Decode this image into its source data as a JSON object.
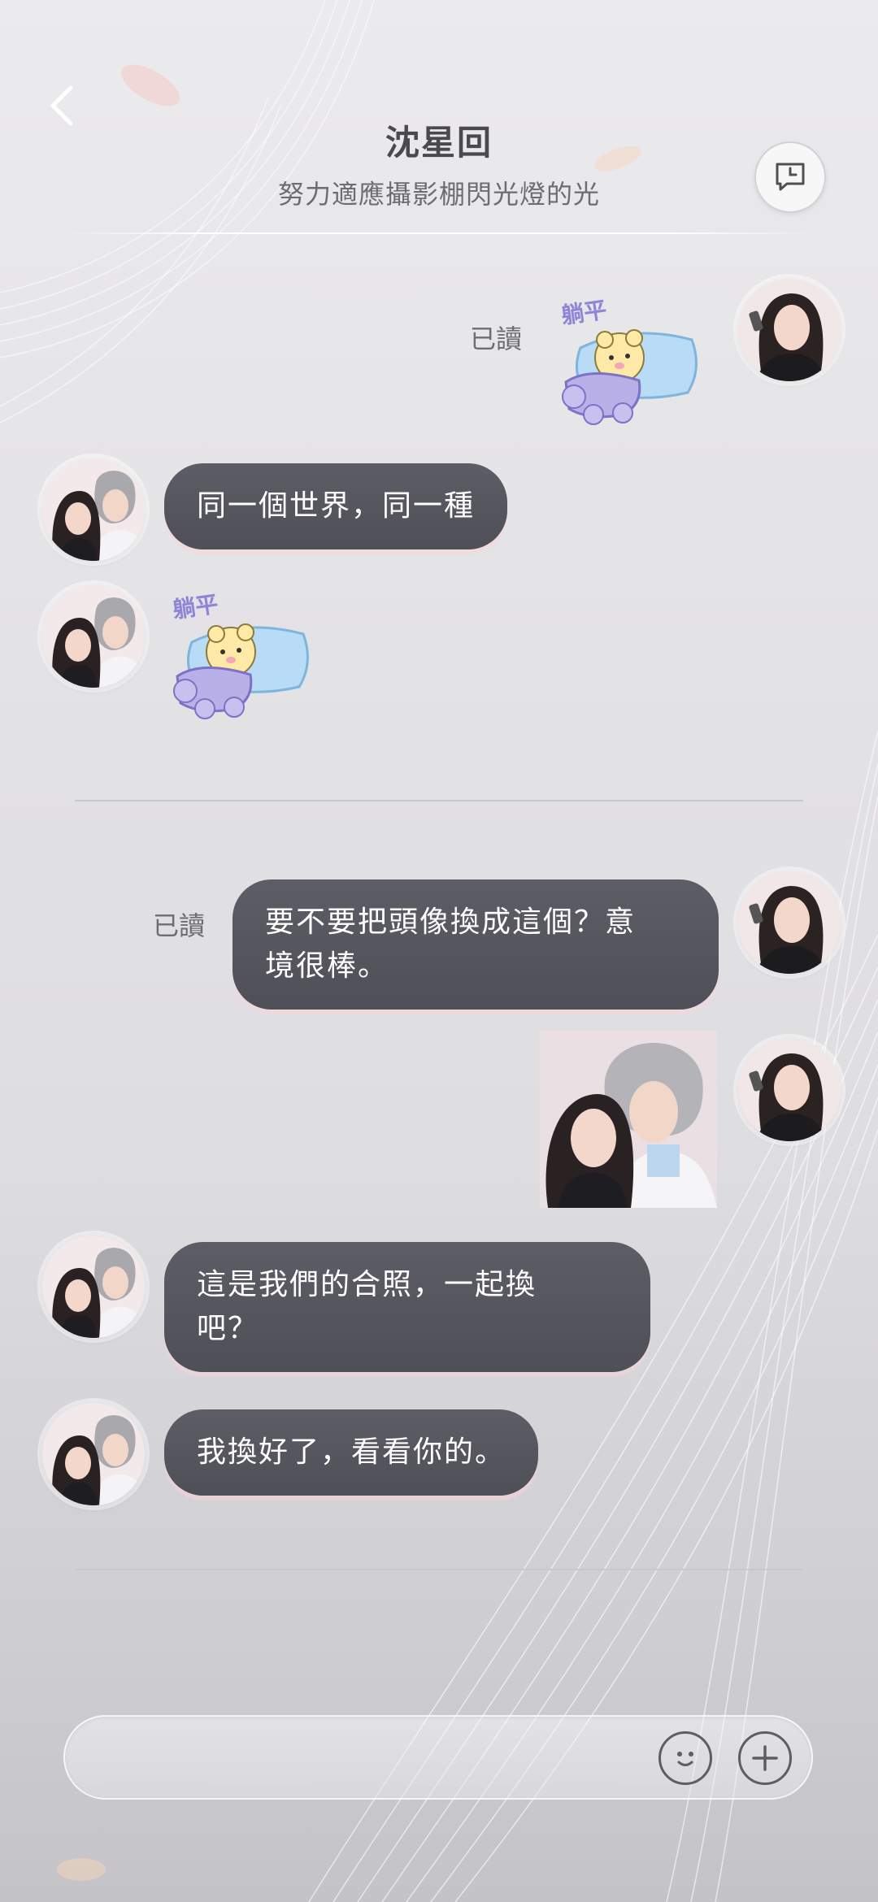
{
  "header": {
    "title": "沈星回",
    "subtitle": "努力適應攝影棚閃光燈的光"
  },
  "messages": {
    "read_status_1": "已讀",
    "sticker_1_text": "躺平",
    "reply_1": "同一個世界，同一種",
    "sticker_2_text": "躺平",
    "read_status_2": "已讀",
    "sent_text_line1": "要不要把頭像換成這個？意",
    "sent_text_line2": "境很棒。",
    "reply_2_line1": "這是我們的合照，一起換",
    "reply_2_line2": "吧？",
    "reply_3": "我換好了，看看你的。"
  },
  "input": {
    "placeholder": ""
  },
  "icons": {
    "back": "chevron-left-icon",
    "history": "chat-history-icon",
    "emoji": "smiley-icon",
    "add": "plus-icon"
  },
  "colors": {
    "bubble": "#55555e",
    "background": "#e4e3e6",
    "sticker_pillow": "#b8dcf5",
    "sticker_blanket": "#b9b0e8",
    "sticker_bear": "#ffe9a6"
  }
}
